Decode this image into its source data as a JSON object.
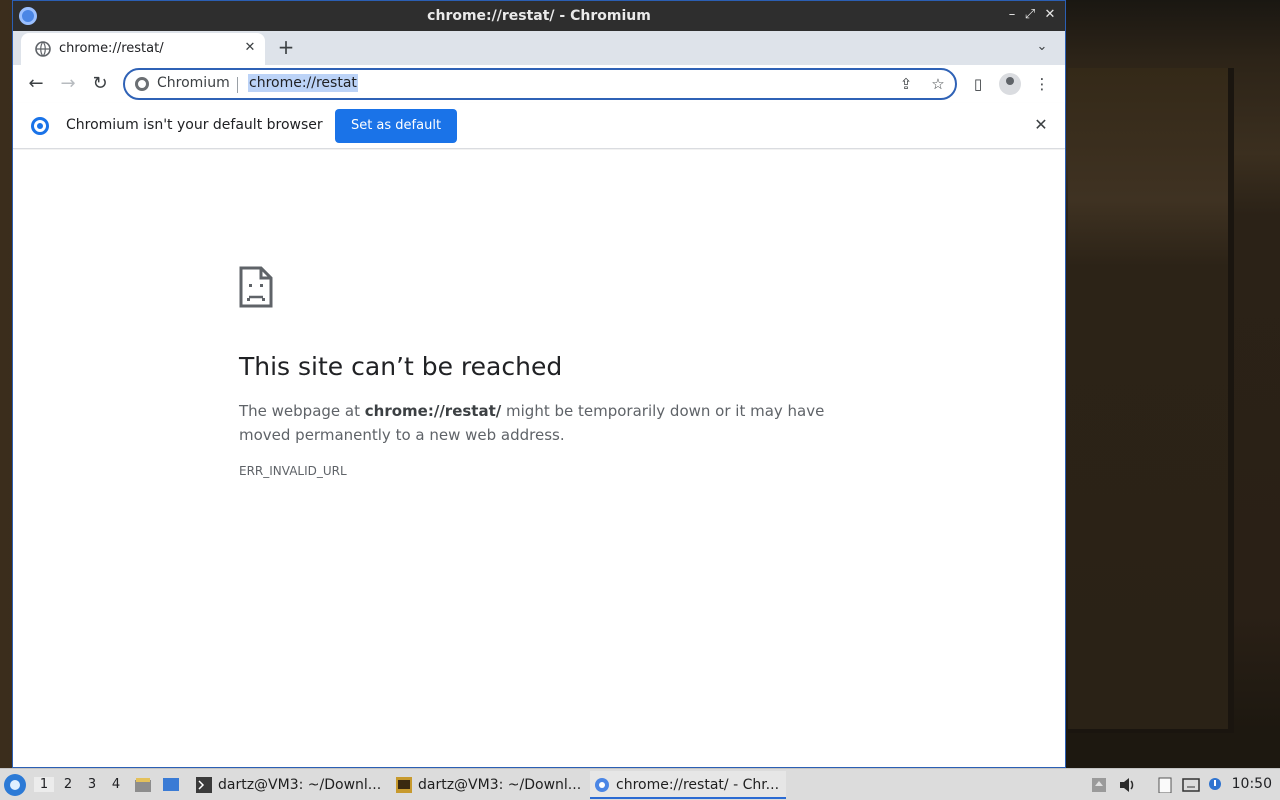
{
  "window": {
    "title": "chrome://restat/ - Chromium"
  },
  "tabs": [
    {
      "title": "chrome://restat/",
      "close_label": "✕"
    }
  ],
  "newtab_label": "+",
  "tabmenu_label": "⌄",
  "toolbar": {
    "back_label": "←",
    "forward_label": "→",
    "reload_label": "↻",
    "site_chip": "Chromium",
    "url": "chrome://restat",
    "share_label": "⇪",
    "bookmark_label": "☆",
    "menu_label": "⋮"
  },
  "infobar": {
    "message": "Chromium isn't your default browser",
    "button_label": "Set as default",
    "close_label": "✕"
  },
  "error": {
    "title": "This site can’t be reached",
    "desc_prefix": "The webpage at ",
    "desc_url": "chrome://restat/",
    "desc_suffix": " might be temporarily down or it may have moved permanently to a new web address.",
    "code": "ERR_INVALID_URL"
  },
  "taskbar": {
    "workspaces": [
      "1",
      "2",
      "3",
      "4"
    ],
    "items": [
      {
        "label": "dartz@VM3: ~/Downl..."
      },
      {
        "label": "dartz@VM3: ~/Downl..."
      },
      {
        "label": "chrome://restat/ - Chr..."
      }
    ],
    "clock": "10:50"
  },
  "colors": {
    "accent": "#1a73e8",
    "titlebar": "#2e2e2e",
    "tabstrip": "#dee3ea",
    "url_highlight": "#bcd3f7"
  }
}
